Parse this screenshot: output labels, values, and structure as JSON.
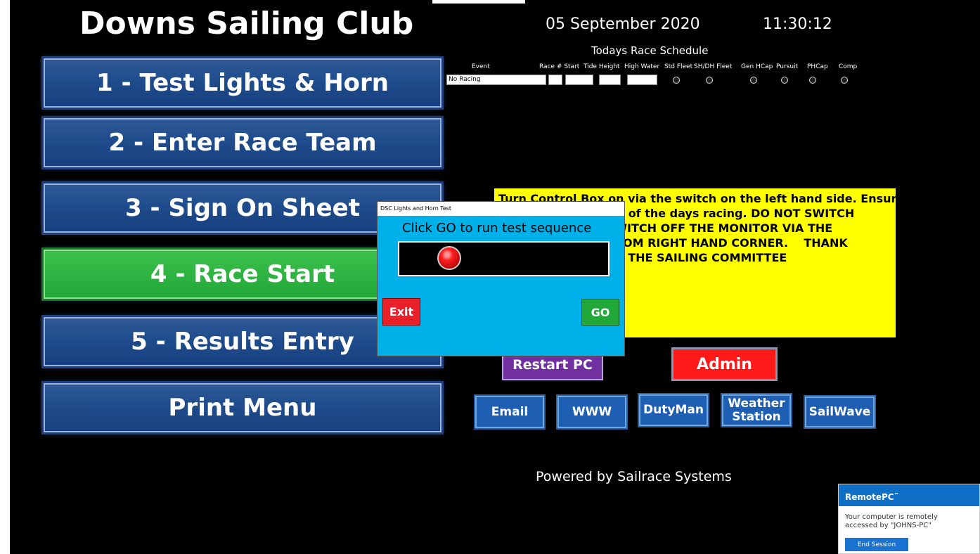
{
  "app": {
    "title": "Downs Sailing Club",
    "date": "05 September 2020",
    "time": "11:30:12"
  },
  "schedule": {
    "title": "Todays Race Schedule",
    "columns": [
      "Event",
      "Race # Start",
      "Tide Height",
      "High Water",
      "Std Fleet",
      "SH/DH Fleet",
      "Gen HCap",
      "Pursuit",
      "PHCap",
      "Comp"
    ],
    "event_value": "No Racing"
  },
  "menu": [
    {
      "label": "1 - Test Lights & Horn"
    },
    {
      "label": "2 - Enter Race Team"
    },
    {
      "label": "3 - Sign On Sheet"
    },
    {
      "label": "4 - Race Start"
    },
    {
      "label": "5 - Results Entry"
    },
    {
      "label": "Print Menu"
    }
  ],
  "notice": {
    "lines": [
      "Turn Control Box on via the switch on the left hand side. Ensure",
      "e end of the days racing. DO NOT SWITCH",
      "LY SWITCH OFF THE MONITOR VIA THE",
      "BOTTOM RIGHT HAND CORNER.    THANK",
      "- THE SAILING COMMITTEE"
    ]
  },
  "buttons": {
    "restart": "Restart PC",
    "admin": "Admin",
    "email": "Email",
    "www": "WWW",
    "dutyman": "DutyMan",
    "weather": "Weather Station",
    "sailwave": "SailWave"
  },
  "footer": "Powered by Sailrace Systems",
  "dialog": {
    "title": "DSC Lights and Horn Test",
    "message": "Click GO to run test sequence",
    "exit": "Exit",
    "go": "GO"
  },
  "remote": {
    "brand": "RemotePC",
    "trademark": "™",
    "message": "Your computer is remotely accessed by \"JOHNS-PC\"",
    "end": "End Session"
  },
  "colors": {
    "menu_blue": "#1f4c8c",
    "menu_green": "#22a838",
    "notice_yellow": "#ffff00",
    "dialog_blue": "#00b0e8",
    "admin_red": "#ff1a1a",
    "restart_purple": "#7030a0"
  }
}
